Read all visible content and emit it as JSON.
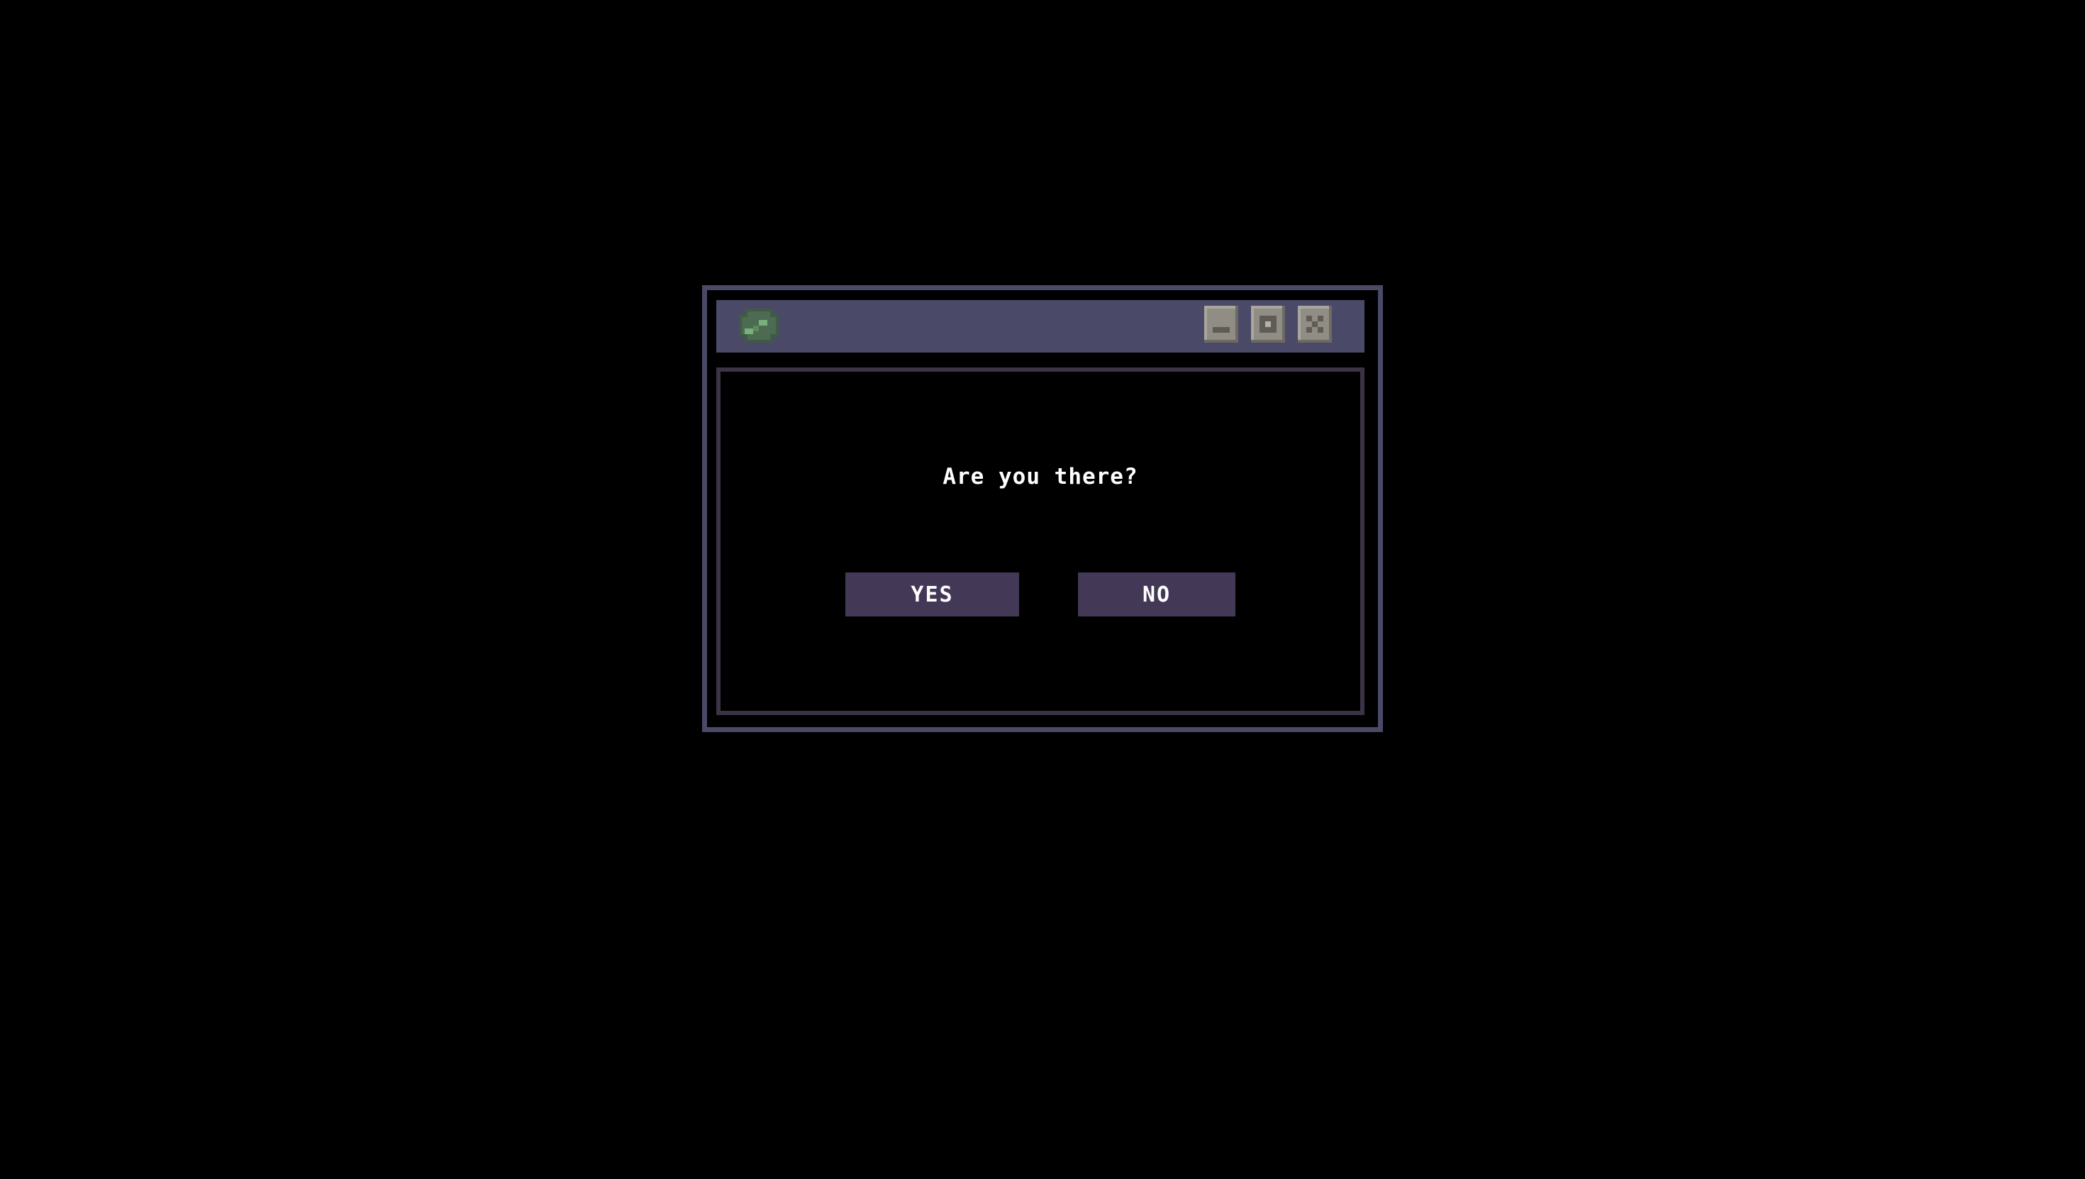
{
  "window": {
    "icon": "green-blob-icon",
    "controls": [
      "minimize-icon",
      "maximize-icon",
      "close-icon"
    ]
  },
  "dialog": {
    "message": "Are you there?",
    "yes_label": "YES",
    "no_label": "NO"
  },
  "colors": {
    "background": "#000000",
    "frame": "#4a4968",
    "content_border": "#3b3346",
    "button": "#433856",
    "control": "#8f8d84",
    "icon_green": "#5d8a5d",
    "text": "#ffffff"
  }
}
